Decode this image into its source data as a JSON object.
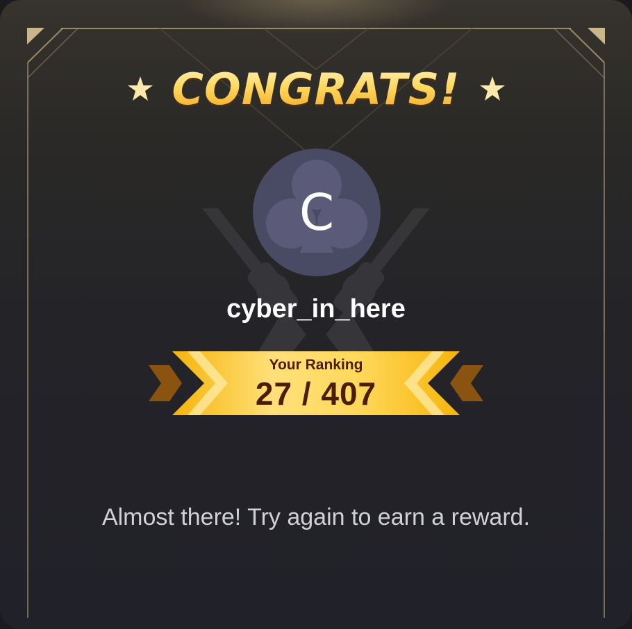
{
  "title": "CONGRATS!",
  "icons": {
    "title_left": "star-icon",
    "title_right": "star-icon",
    "avatar_background": "club-suit-icon",
    "background_art": "crossed-revolvers-icon",
    "ribbon_left": "chevron-right-icon",
    "ribbon_right": "chevron-left-icon"
  },
  "player": {
    "avatar_letter": "C",
    "username": "cyber_in_here"
  },
  "ranking": {
    "label": "Your Ranking",
    "value": "27 / 407",
    "rank": 27,
    "total": 407
  },
  "message": "Almost there! Try again to earn a reward.",
  "colors": {
    "gold": "#ffc51e",
    "rank_text": "#4a1d05",
    "avatar": "#494a63",
    "frame": "#c9b68a"
  }
}
